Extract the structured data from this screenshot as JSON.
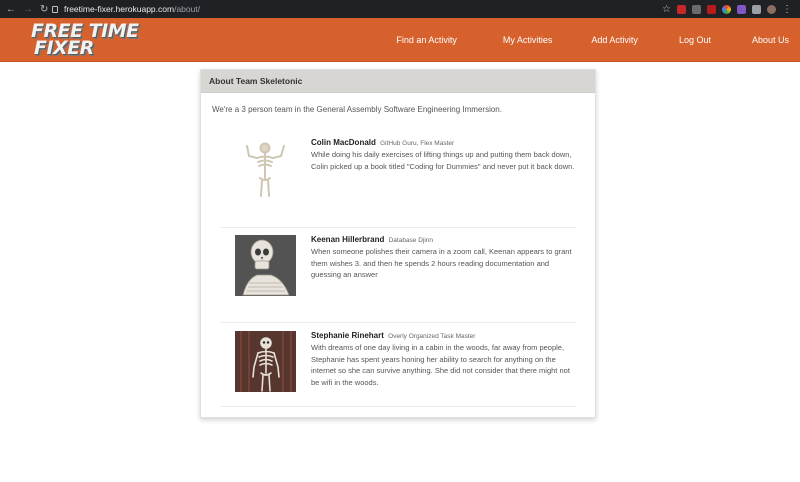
{
  "browser": {
    "url_host": "freetime-fixer.herokuapp.com",
    "url_path": "/about/"
  },
  "site": {
    "logo_line1": "FREE TIME",
    "logo_line2": "FIXER",
    "brand_color": "#d6612d",
    "nav": {
      "find": "Find an Activity",
      "mine": "My Activities",
      "add": "Add Activity",
      "logout": "Log Out",
      "about": "About Us"
    }
  },
  "about": {
    "heading": "About Team Skeletonic",
    "intro": "We're a 3 person team in the General Assembly Software Engineering Immersion.",
    "members": [
      {
        "name": "Colin MacDonald",
        "role": "GitHub Guru, Flex Master",
        "bio": "While doing his daily exercises of lifting things up and putting them back down, Colin picked up a book titled \"Coding for Dummies\" and never put it back down."
      },
      {
        "name": "Keenan Hillerbrand",
        "role": "Database Djinn",
        "bio": "When someone polishes their camera in a zoom call, Keenan appears to grant them wishes 3. and then he spends 2 hours reading documentation and guessing an answer"
      },
      {
        "name": "Stephanie Rinehart",
        "role": "Overly Organized Task Master",
        "bio": "With dreams of one day living in a cabin in the woods, far away from people, Stephanie has spent years honing her ability to search for anything on the internet so she can survive anything. She did not consider that there might not be wifi in the woods."
      }
    ]
  }
}
